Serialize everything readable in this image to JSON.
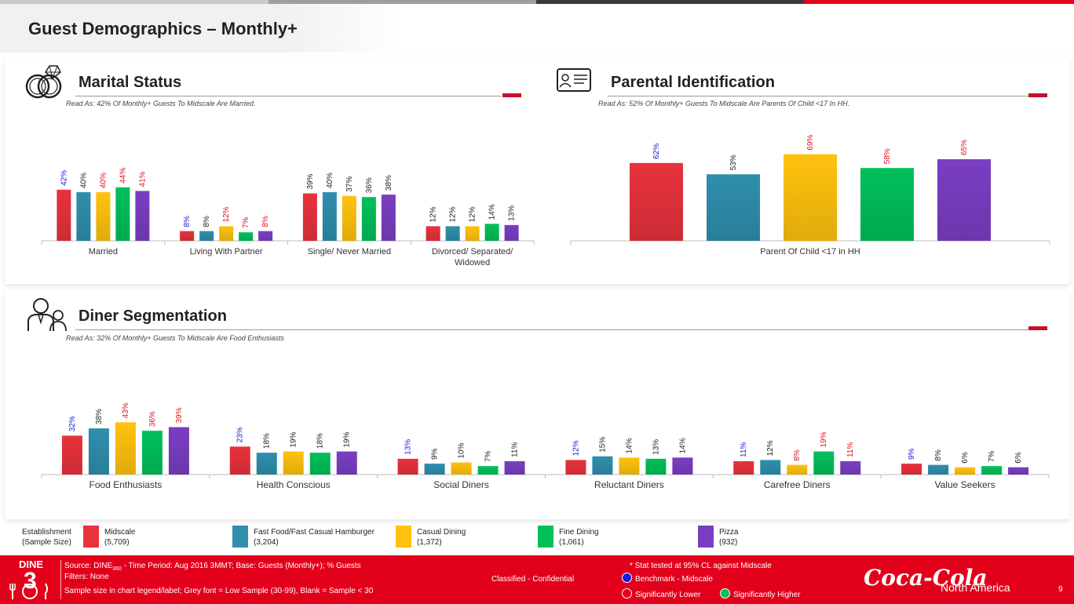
{
  "page": {
    "title": "Guest Demographics – Monthly+",
    "page_number": "9"
  },
  "colors": {
    "midscale": "#e8323c",
    "fast_food": "#2f8fad",
    "casual": "#ffc20e",
    "fine": "#00c05a",
    "pizza": "#7a3ec3",
    "lower": "#1a1adb",
    "higher": "#e01020",
    "neutral": "#222222",
    "brand_red": "#e3001b"
  },
  "sections": {
    "marital": {
      "title": "Marital Status",
      "read_as": "Read As: 42% Of Monthly+ Guests To Midscale Are Married."
    },
    "parental": {
      "title": "Parental Identification",
      "read_as": "Read As: 52% Of Monthly+ Guests To Midscale Are Parents Of Child <17 In HH."
    },
    "diner": {
      "title": "Diner Segmentation",
      "read_as": "Read As: 32% Of Monthly+ Guests To Midscale Are Food Enthusiasts"
    }
  },
  "chart_data": [
    {
      "type": "bar",
      "id": "marital",
      "categories": [
        "Married",
        "Living With Partner",
        "Single/ Never Married",
        "Divorced/ Separated/ Widowed"
      ],
      "category_lines": [
        [
          "Married"
        ],
        [
          "Living With Partner"
        ],
        [
          "Single/ Never Married"
        ],
        [
          "Divorced/ Separated/",
          "Widowed"
        ]
      ],
      "series": [
        {
          "name": "Midscale",
          "color_key": "midscale",
          "values": [
            42,
            8,
            39,
            12
          ],
          "sig": [
            "lower",
            "lower",
            "neutral",
            "neutral"
          ]
        },
        {
          "name": "Fast Food/Fast Casual Hamburger",
          "color_key": "fast_food",
          "values": [
            40,
            8,
            40,
            12
          ],
          "sig": [
            "neutral",
            "neutral",
            "neutral",
            "neutral"
          ]
        },
        {
          "name": "Casual Dining",
          "color_key": "casual",
          "values": [
            40,
            12,
            37,
            12
          ],
          "sig": [
            "higher",
            "higher",
            "neutral",
            "neutral"
          ]
        },
        {
          "name": "Fine Dining",
          "color_key": "fine",
          "values": [
            44,
            7,
            36,
            14
          ],
          "sig": [
            "higher",
            "higher",
            "neutral",
            "neutral"
          ]
        },
        {
          "name": "Pizza",
          "color_key": "pizza",
          "values": [
            41,
            8,
            38,
            13
          ],
          "sig": [
            "higher",
            "higher",
            "neutral",
            "neutral"
          ]
        }
      ],
      "value_labels": [
        [
          "42%",
          "8%",
          "39%",
          "12%"
        ],
        [
          "40%",
          "8%",
          "40%",
          "12%"
        ],
        [
          "40%",
          "12%",
          "37%",
          "12%"
        ],
        [
          "44%",
          "7%",
          "36%",
          "14%"
        ],
        [
          "41%",
          "8%",
          "38%",
          "13%"
        ]
      ],
      "ylim": [
        0,
        80
      ]
    },
    {
      "type": "bar",
      "id": "parental",
      "categories": [
        "Parent Of Child <17 in HH"
      ],
      "category_lines": [
        [
          "Parent Of Child <17 in HH"
        ]
      ],
      "series": [
        {
          "name": "Midscale",
          "color_key": "midscale",
          "values": [
            62
          ],
          "sig": [
            "lower"
          ]
        },
        {
          "name": "Fast Food/Fast Casual Hamburger",
          "color_key": "fast_food",
          "values": [
            53
          ],
          "sig": [
            "neutral"
          ]
        },
        {
          "name": "Casual Dining",
          "color_key": "casual",
          "values": [
            69
          ],
          "sig": [
            "higher"
          ]
        },
        {
          "name": "Fine Dining",
          "color_key": "fine",
          "values": [
            58
          ],
          "sig": [
            "higher"
          ]
        },
        {
          "name": "Pizza",
          "color_key": "pizza",
          "values": [
            65
          ],
          "sig": [
            "higher"
          ]
        }
      ],
      "value_labels": [
        [
          "62%"
        ],
        [
          "53%"
        ],
        [
          "69%"
        ],
        [
          "58%"
        ],
        [
          "65%"
        ]
      ],
      "ylim": [
        0,
        100
      ]
    },
    {
      "type": "bar",
      "id": "diner",
      "categories": [
        "Food Enthusiasts",
        "Health Conscious",
        "Social Diners",
        "Reluctant Diners",
        "Carefree Diners",
        "Value Seekers"
      ],
      "category_lines": [
        [
          "Food Enthusiasts"
        ],
        [
          "Health Conscious"
        ],
        [
          "Social Diners"
        ],
        [
          "Reluctant Diners"
        ],
        [
          "Carefree Diners"
        ],
        [
          "Value Seekers"
        ]
      ],
      "series": [
        {
          "name": "Midscale",
          "color_key": "midscale",
          "values": [
            32,
            23,
            13,
            12,
            11,
            9
          ],
          "sig": [
            "lower",
            "lower",
            "lower",
            "lower",
            "lower",
            "lower"
          ]
        },
        {
          "name": "Fast Food/Fast Casual Hamburger",
          "color_key": "fast_food",
          "values": [
            38,
            18,
            9,
            15,
            12,
            8
          ],
          "sig": [
            "neutral",
            "neutral",
            "neutral",
            "neutral",
            "neutral",
            "neutral"
          ]
        },
        {
          "name": "Casual Dining",
          "color_key": "casual",
          "values": [
            43,
            19,
            10,
            14,
            8,
            6
          ],
          "sig": [
            "higher",
            "neutral",
            "neutral",
            "neutral",
            "higher",
            "neutral"
          ]
        },
        {
          "name": "Fine Dining",
          "color_key": "fine",
          "values": [
            36,
            18,
            7,
            13,
            19,
            7
          ],
          "sig": [
            "higher",
            "neutral",
            "neutral",
            "neutral",
            "higher",
            "neutral"
          ]
        },
        {
          "name": "Pizza",
          "color_key": "pizza",
          "values": [
            39,
            19,
            11,
            14,
            11,
            6
          ],
          "sig": [
            "higher",
            "neutral",
            "neutral",
            "neutral",
            "higher",
            "neutral"
          ]
        }
      ],
      "value_labels": [
        [
          "32%",
          "23%",
          "13%",
          "12%",
          "11%",
          "9%"
        ],
        [
          "38%",
          "18%",
          "9%",
          "15%",
          "12%",
          "8%"
        ],
        [
          "43%",
          "19%",
          "10%",
          "14%",
          "8%",
          "6%"
        ],
        [
          "36%",
          "18%",
          "7%",
          "13%",
          "19%",
          "7%"
        ],
        [
          "39%",
          "19%",
          "11%",
          "14%",
          "11%",
          "6%"
        ]
      ],
      "ylim": [
        0,
        65
      ]
    }
  ],
  "legend": {
    "establishment_line1": "Establishment",
    "establishment_line2": "(Sample Size)",
    "items": [
      {
        "name": "Midscale",
        "sample": "(5,709)",
        "color_key": "midscale"
      },
      {
        "name": "Fast Food/Fast Casual Hamburger",
        "sample": "(3,204)",
        "color_key": "fast_food"
      },
      {
        "name": "Casual Dining",
        "sample": "(1,372)",
        "color_key": "casual"
      },
      {
        "name": "Fine Dining",
        "sample": "(1,061)",
        "color_key": "fine"
      },
      {
        "name": "Pizza",
        "sample": "(932)",
        "color_key": "pizza"
      }
    ]
  },
  "footer": {
    "logo_text": "DINE",
    "logo_numeral": "3",
    "source_prefix": "Source: DINE",
    "source_sub": "360",
    "source_rest": " - Time Period: Aug 2016 3MMT; Base: Guests (Monthly+); % Guests",
    "filters": "Filters: None",
    "sample_note": "Sample size in chart legend/label;  Grey font = Low Sample (30-99), Blank = Sample < 30",
    "classification": "Classified - Confidential",
    "stat_note": "* Stat tested at 95% CL against Midscale",
    "benchmark": "Benchmark - Midscale",
    "sig_lower": "Significantly Lower",
    "sig_higher": "Significantly Higher",
    "brand_script": "Coca-Cola",
    "brand_region": "North America"
  }
}
